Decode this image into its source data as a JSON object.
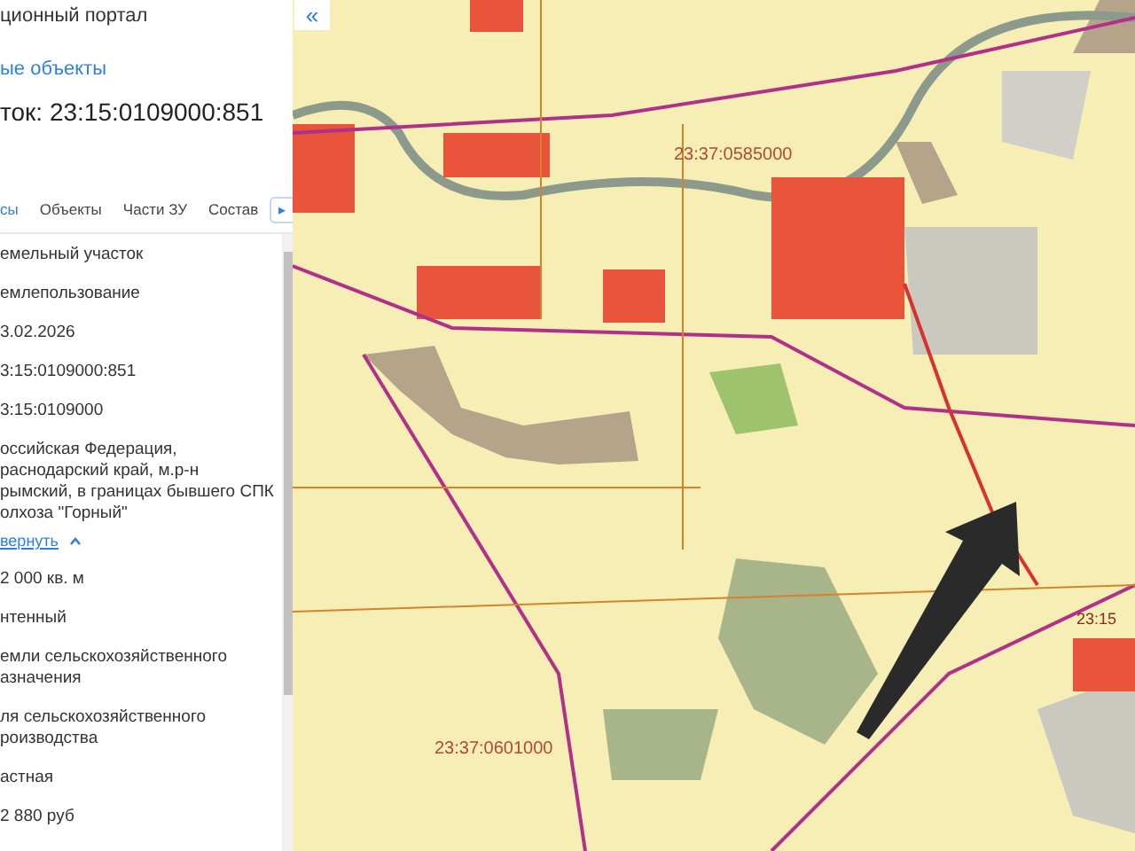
{
  "header": {
    "portal_title": "ционный портал",
    "link": "ые объекты",
    "object_title": "ток: 23:15:0109000:851"
  },
  "tabs": [
    {
      "label": "сы",
      "selected": true
    },
    {
      "label": "Объекты",
      "selected": false
    },
    {
      "label": "Части ЗУ",
      "selected": false
    },
    {
      "label": "Состав",
      "selected": false
    }
  ],
  "tabs_next": "▸",
  "fields": [
    {
      "kind": "text",
      "lines": [
        "емельный участок"
      ]
    },
    {
      "kind": "text",
      "lines": [
        "емлепользование"
      ]
    },
    {
      "kind": "text",
      "lines": [
        "3.02.2026"
      ]
    },
    {
      "kind": "text",
      "lines": [
        "3:15:0109000:851"
      ]
    },
    {
      "kind": "text",
      "lines": [
        "3:15:0109000"
      ]
    },
    {
      "kind": "text",
      "lines": [
        "оссийская Федерация,",
        "раснодарский край, м.р-н",
        "рымский, в границах бывшего СПК",
        "олхоза \"Горный\""
      ]
    },
    {
      "kind": "link",
      "lines": [
        "вернуть"
      ]
    },
    {
      "kind": "text",
      "lines": [
        "2 000 кв. м"
      ]
    },
    {
      "kind": "text",
      "lines": [
        "нтенный"
      ]
    },
    {
      "kind": "text",
      "lines": [
        "емли сельскохозяйственного",
        "азначения"
      ]
    },
    {
      "kind": "text",
      "lines": [
        "ля сельскохозяйственного",
        "роизводства"
      ]
    },
    {
      "kind": "text",
      "lines": [
        "астная"
      ]
    },
    {
      "kind": "text",
      "lines": [
        "2 880 руб"
      ]
    }
  ],
  "map": {
    "collapse_button": "«",
    "labels": [
      "23:37:0585000",
      "23:37:0601000",
      "23:15"
    ]
  }
}
